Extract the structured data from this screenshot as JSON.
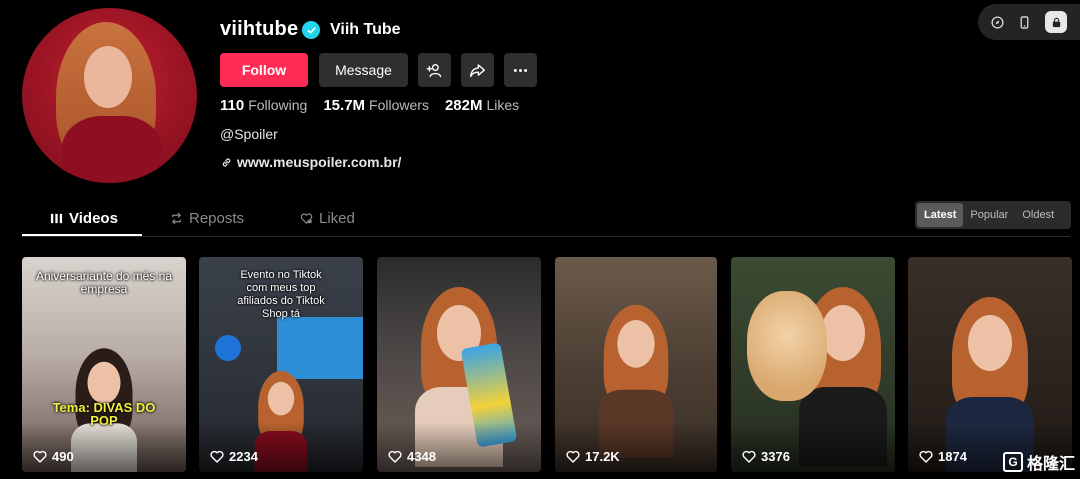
{
  "profile": {
    "username": "viihtube",
    "nickname": "Viih Tube",
    "bio": "@Spoiler",
    "link": "www.meuspoiler.com.br/"
  },
  "actions": {
    "follow_label": "Follow",
    "message_label": "Message"
  },
  "stats": {
    "following_count": "110",
    "following_label": "Following",
    "followers_count": "15.7M",
    "followers_label": "Followers",
    "likes_count": "282M",
    "likes_label": "Likes"
  },
  "tabs": [
    {
      "label": "Videos",
      "active": true
    },
    {
      "label": "Reposts",
      "active": false
    },
    {
      "label": "Liked",
      "active": false
    }
  ],
  "sort": {
    "options": [
      "Latest",
      "Popular",
      "Oldest"
    ],
    "selected": "Latest"
  },
  "videos": [
    {
      "views": "490",
      "caption_top": "Aniversariante do mês na empresa",
      "caption_bottom": "Tema: DIVAS DO POP"
    },
    {
      "views": "2234",
      "caption_top": "Evento no Tiktok com meus top afiliados do Tiktok Shop tá"
    },
    {
      "views": "4348"
    },
    {
      "views": "17.2K"
    },
    {
      "views": "3376"
    },
    {
      "views": "1874"
    }
  ],
  "watermark": {
    "text": "格隆汇",
    "logo": "G"
  },
  "colors": {
    "follow": "#fe2c55",
    "verified": "#20d5ec",
    "background": "#000000"
  },
  "icons": {
    "verified": "verified-badge-icon",
    "add_user": "add-user-icon",
    "share": "share-icon",
    "more": "more-icon",
    "link": "link-icon",
    "videos": "grid-icon",
    "reposts": "repost-icon",
    "liked": "heart-lock-icon",
    "views": "heart-icon"
  }
}
